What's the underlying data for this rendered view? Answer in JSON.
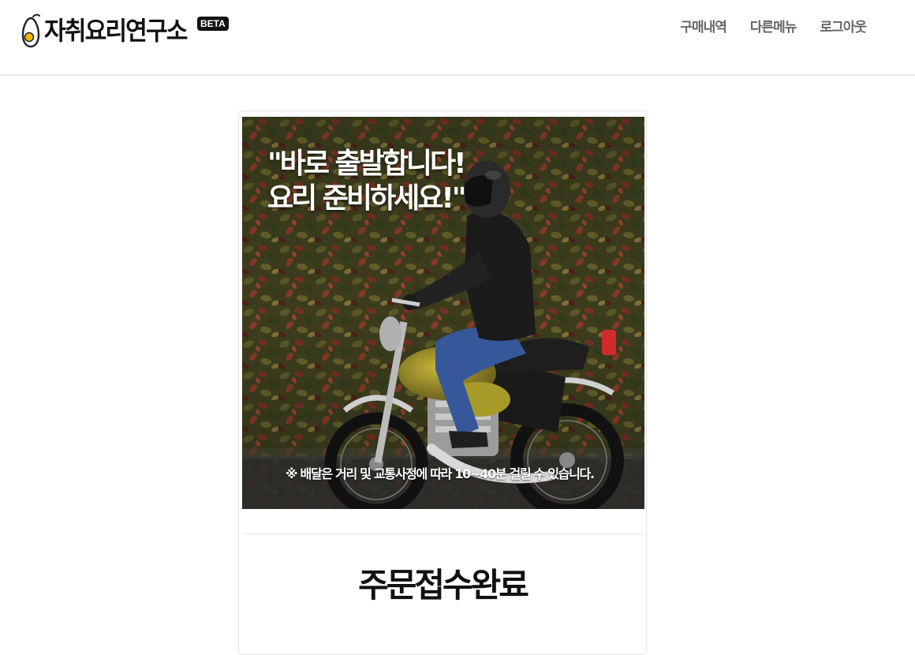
{
  "header": {
    "logo_text": "자취요리연구소",
    "beta_badge": "BETA",
    "nav": [
      {
        "label": "구매내역"
      },
      {
        "label": "다른메뉴"
      },
      {
        "label": "로그아웃"
      }
    ]
  },
  "banner": {
    "headline": "\"바로 출발합니다!\n요리 준비하세요!\"",
    "note": "※ 배달은 거리 및 교통사정에 따라 10~40분 걸릴 수 있습니다."
  },
  "order": {
    "status_title": "주문접수완료"
  },
  "colors": {
    "text": "#111111",
    "nav_text": "#666666",
    "border": "#e3e3e3",
    "egg_yolk": "#f5b400"
  }
}
